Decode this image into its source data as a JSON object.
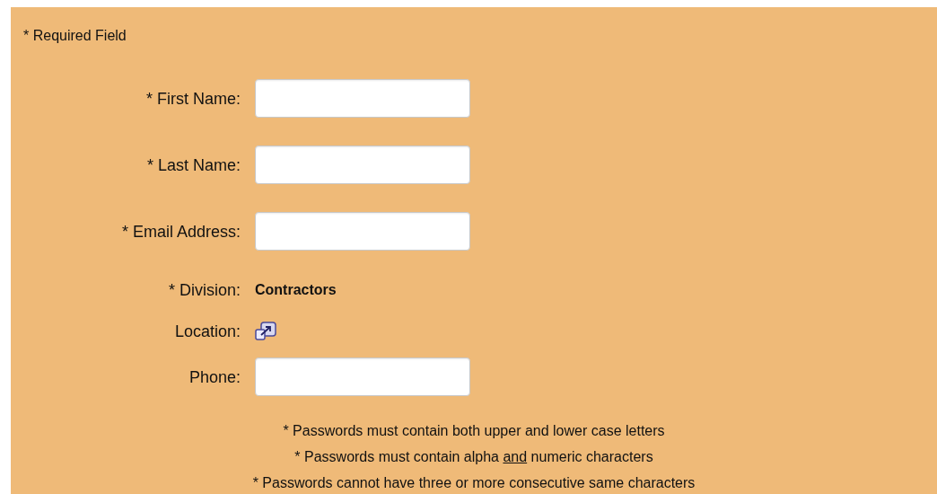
{
  "note": "* Required Field",
  "fields": [
    {
      "kind": "input",
      "label": "* First Name:"
    },
    {
      "kind": "input",
      "label": "* Last Name:"
    },
    {
      "kind": "input",
      "label": "* Email Address:"
    },
    {
      "kind": "text",
      "label": "* Division:",
      "value": "Contractors"
    },
    {
      "kind": "icon",
      "label": "Location:"
    },
    {
      "kind": "input",
      "label": "Phone:"
    }
  ],
  "rules": [
    {
      "parts": [
        {
          "text": "* Passwords must contain both upper and lower case letters",
          "underline": false
        }
      ]
    },
    {
      "parts": [
        {
          "text": "* Passwords must contain alpha ",
          "underline": false
        },
        {
          "text": "and",
          "underline": true
        },
        {
          "text": " numeric characters",
          "underline": false
        }
      ]
    },
    {
      "parts": [
        {
          "text": "* Passwords cannot have three or more consecutive same characters",
          "underline": false
        }
      ]
    }
  ]
}
